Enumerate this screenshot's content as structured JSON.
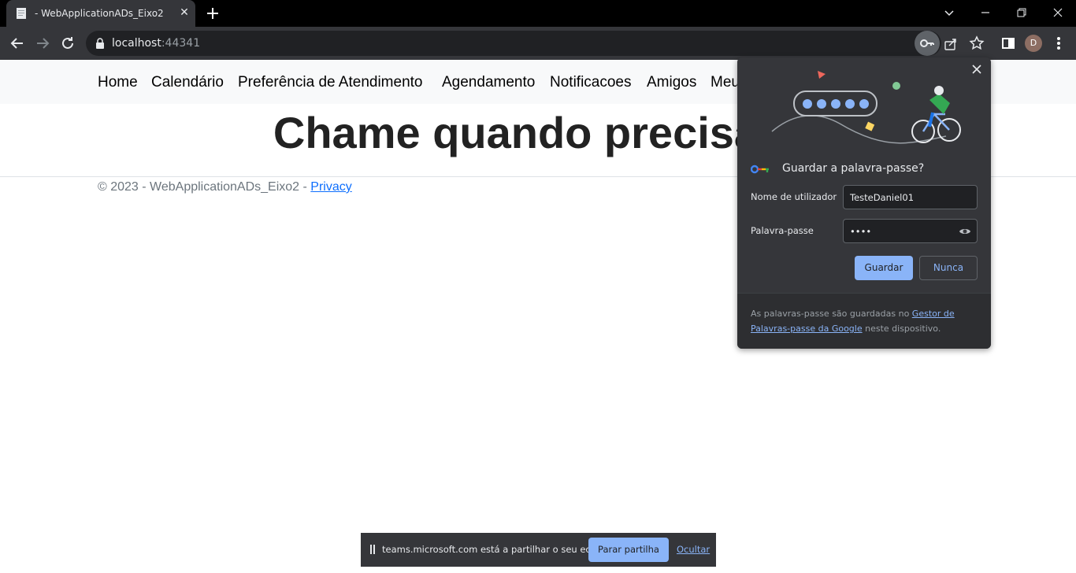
{
  "tab": {
    "title": "- WebApplicationADs_Eixo2",
    "close": "✕"
  },
  "omnibox": {
    "host": "localhost",
    "port": ":44341"
  },
  "profile": {
    "initial": "D"
  },
  "nav": {
    "items": [
      {
        "label": "Home"
      },
      {
        "label": "Calendário"
      },
      {
        "label": "Preferência de Atendimento"
      },
      {
        "label": "Agendamento"
      },
      {
        "label": "Notificacoes"
      },
      {
        "label": "Amigos"
      },
      {
        "label": "Meu"
      }
    ]
  },
  "main": {
    "heading": "Chame quando precisa"
  },
  "footer": {
    "text": "© 2023 - WebApplicationADs_Eixo2 - ",
    "link": "Privacy"
  },
  "password_bubble": {
    "title": "Guardar a palavra-passe?",
    "username_label": "Nome de utilizador",
    "username_value": "TesteDaniel01",
    "password_label": "Palavra-passe",
    "password_value": "••••",
    "save_label": "Guardar",
    "never_label": "Nunca",
    "footer_prefix": "As palavras-passe são guardadas no ",
    "footer_link": "Gestor de Palavras-passe da Google",
    "footer_suffix": " neste dispositivo."
  },
  "share_bar": {
    "message": "teams.microsoft.com está a partilhar o seu ecrã.",
    "stop_label": "Parar partilha",
    "hide_label": "Ocultar"
  },
  "colors": {
    "accent": "#8ab4f8",
    "chrome_dark": "#35363a",
    "link_blue": "#0d6efd"
  }
}
